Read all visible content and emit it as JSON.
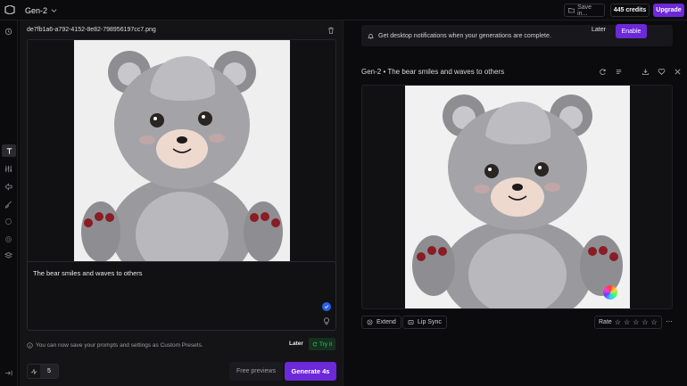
{
  "topbar": {
    "model": "Gen-2",
    "save_label": "Save in...",
    "credits": "445 credits",
    "upgrade": "Upgrade"
  },
  "rail": {
    "icons": [
      "history-icon",
      "text-icon",
      "sliders-icon",
      "camera-motion-icon",
      "brush-icon",
      "sparkle-icon",
      "circle-icon",
      "layers-icon",
      "collapse-icon"
    ]
  },
  "left": {
    "filename": "de7fb1a6-a792-4152-8e82-798956197cc7.png",
    "prompt": "The bear smiles and waves to others",
    "presets_message": "You can now save your prompts and settings as Custom Presets.",
    "presets_later": "Later",
    "presets_try": "Try it",
    "duration": "5",
    "free_previews": "Free previews",
    "generate": "Generate 4s"
  },
  "right": {
    "notification": "Get desktop notifications when your generations are complete.",
    "notif_later": "Later",
    "notif_enable": "Enable",
    "title": "Gen-2 • The bear smiles and waves to others",
    "extend": "Extend",
    "lip_sync": "Lip Sync",
    "rate": "Rate",
    "rating": 0
  },
  "colors": {
    "accent": "#6d28d9",
    "success": "#39c46a",
    "background": "#0b0b0d"
  }
}
